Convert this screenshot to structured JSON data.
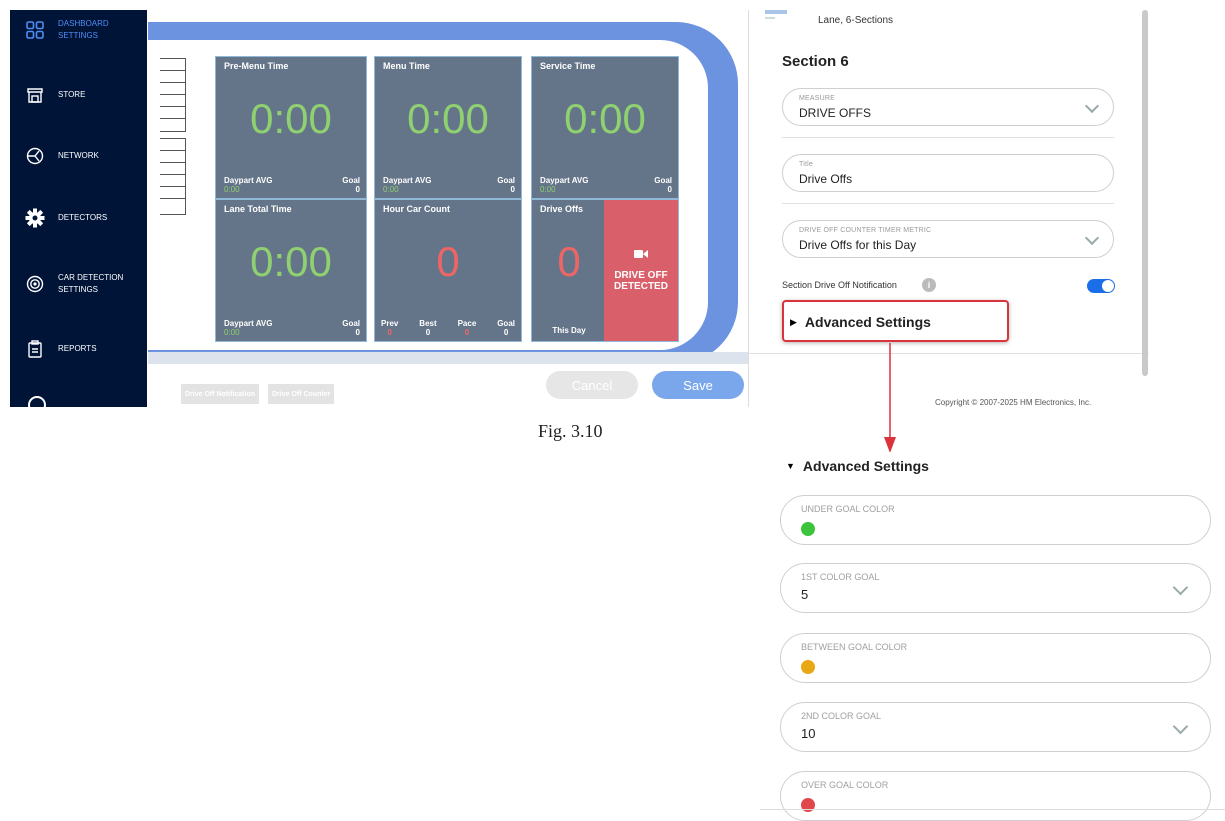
{
  "sidebar": {
    "items": [
      {
        "label_1": "DASHBOARD",
        "label_2": "SETTINGS",
        "icon": "dashboard-grid-icon",
        "active": true
      },
      {
        "label_1": "STORE",
        "label_2": "",
        "icon": "store-icon"
      },
      {
        "label_1": "NETWORK",
        "label_2": "",
        "icon": "network-icon"
      },
      {
        "label_1": "DETECTORS",
        "label_2": "",
        "icon": "gear-icon"
      },
      {
        "label_1": "CAR DETECTION",
        "label_2": "SETTINGS",
        "icon": "radar-icon"
      },
      {
        "label_1": "REPORTS",
        "label_2": "",
        "icon": "clipboard-icon"
      }
    ]
  },
  "tiles": {
    "premenu": {
      "title": "Pre-Menu Time",
      "value": "0:00",
      "foot_left": "Daypart AVG",
      "foot_left_sub": "0:00",
      "foot_right": "Goal",
      "foot_right_sub": "0"
    },
    "menu": {
      "title": "Menu Time",
      "value": "0:00",
      "foot_left": "Daypart AVG",
      "foot_left_sub": "0:00",
      "foot_right": "Goal",
      "foot_right_sub": "0"
    },
    "service": {
      "title": "Service Time",
      "value": "0:00",
      "foot_left": "Daypart AVG",
      "foot_left_sub": "0:00",
      "foot_right": "Goal",
      "foot_right_sub": "0"
    },
    "lane": {
      "title": "Lane Total Time",
      "value": "0:00",
      "foot_left": "Daypart AVG",
      "foot_left_sub": "0:00",
      "foot_right": "Goal",
      "foot_right_sub": "0"
    },
    "hourcar": {
      "title": "Hour Car Count",
      "value": "0",
      "stats": [
        {
          "label": "Prev",
          "val": "0",
          "red": true
        },
        {
          "label": "Best",
          "val": "0",
          "red": false
        },
        {
          "label": "Pace",
          "val": "0",
          "red": true
        },
        {
          "label": "Goal",
          "val": "0",
          "red": false
        }
      ]
    },
    "driveoffs": {
      "title": "Drive Offs",
      "value": "0",
      "foot": "This Day",
      "alert_1": "DRIVE OFF",
      "alert_2": "DETECTED"
    }
  },
  "bottom": {
    "chip_1": "Drive Off Notification",
    "chip_2": "Drive Off Counter",
    "cancel": "Cancel",
    "save": "Save"
  },
  "rpanel": {
    "header": "Lane, 6-Sections",
    "section_title": "Section 6",
    "measure": {
      "caption": "MEASURE",
      "value": "DRIVE OFFS"
    },
    "title_field": {
      "caption": "Title",
      "value": "Drive Offs"
    },
    "timer_metric": {
      "caption": "DRIVE OFF COUNTER TIMER METRIC",
      "value": "Drive Offs for this Day"
    },
    "notification_label": "Section Drive Off Notification",
    "notification_on": true,
    "advanced": "Advanced Settings",
    "copyright": "Copyright © 2007-2025 HM Electronics, Inc."
  },
  "caption": "Fig. 3.10",
  "advanced_expanded": {
    "title": "Advanced Settings",
    "fields": [
      {
        "caption": "UNDER GOAL COLOR",
        "color": "#3cc43c"
      },
      {
        "caption": "1ST COLOR GOAL",
        "value": "5"
      },
      {
        "caption": "BETWEEN GOAL COLOR",
        "color": "#e8a814"
      },
      {
        "caption": "2ND COLOR GOAL",
        "value": "10"
      },
      {
        "caption": "OVER GOAL COLOR",
        "color": "#e0474c"
      }
    ]
  },
  "colors": {
    "accent": "#1a6fe8",
    "highlight": "#d9343c",
    "sidebar": "#001438"
  }
}
